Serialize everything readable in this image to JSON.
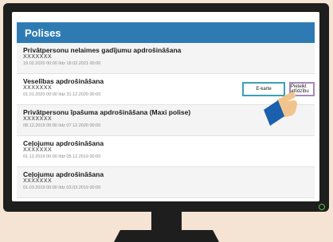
{
  "header": {
    "title": "Polises"
  },
  "policies": [
    {
      "title": "Privātpersonu nelaimes gadījumu apdrošināšana",
      "id": "XXXXXXX",
      "dates": "19.02.2020 00:00 līdz 18.02.2021 00:00"
    },
    {
      "title": "Veselības apdrošināšana",
      "id": "XXXXXXX",
      "dates": "01.01.2020 00:00 līdz 31.12.2020 00:00"
    },
    {
      "title": "Privātpersonu īpašuma apdrošināšana (Maxi polise)",
      "id": "XXXXXXX",
      "dates": "08.12.2019 00:00 līdz 07.12.2020 00:00"
    },
    {
      "title": "Ceļojumu apdrošināšana",
      "id": "XXXXXXX",
      "dates": "01.12.2019 00:00 līdz 05.12.2019 00:00"
    },
    {
      "title": "Ceļojumu apdrošināšana",
      "id": "XXXXXXX",
      "dates": "01.03.2019 00:00 līdz 03.03.2019 00:00"
    }
  ],
  "actions": {
    "ekarte_label": "E-karte",
    "pieteikt_label": "Pieteikt atlīdzību"
  },
  "colors": {
    "header": "#2e7bb4",
    "ekarte_border": "#3aa0b5",
    "pieteikt_border": "#a787b8",
    "background": "#f5e3d3",
    "monitor": "#1e1e1e"
  }
}
